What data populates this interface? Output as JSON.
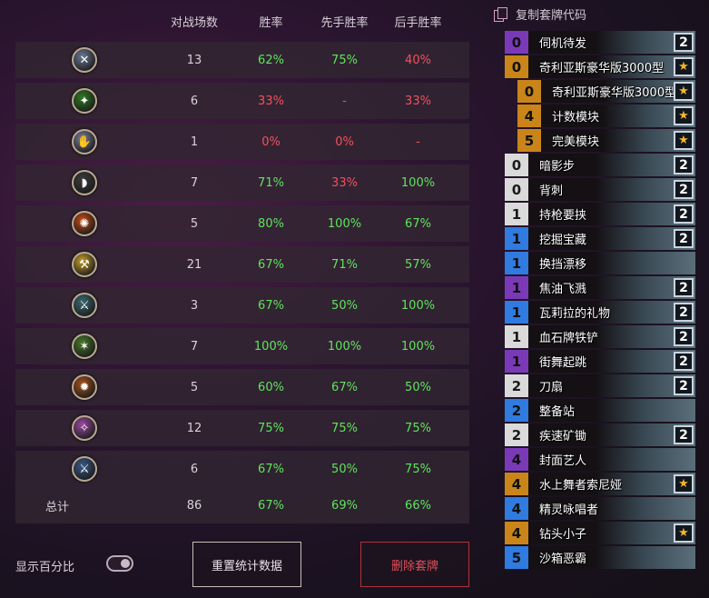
{
  "stats": {
    "headers": {
      "games": "对战场数",
      "winrate": "胜率",
      "first": "先手胜率",
      "second": "后手胜率"
    },
    "rows": [
      {
        "icon": "warrior-class-icon",
        "icon_color": "#6c7a96",
        "glyph": "✕",
        "games": "13",
        "winrate": "62%",
        "first": "75%",
        "second": "40%"
      },
      {
        "icon": "druid-class-icon",
        "icon_color": "#2f7a22",
        "glyph": "✦",
        "games": "6",
        "winrate": "33%",
        "first": "-",
        "second": "33%"
      },
      {
        "icon": "shaman-class-icon",
        "icon_color": "#7a7f9a",
        "glyph": "✋",
        "games": "1",
        "winrate": "0%",
        "first": "0%",
        "second": "-"
      },
      {
        "icon": "rogue-class-icon",
        "icon_color": "#3b3b3b",
        "glyph": "◗",
        "games": "7",
        "winrate": "71%",
        "first": "33%",
        "second": "100%"
      },
      {
        "icon": "mage-class-icon",
        "icon_color": "#c24a16",
        "glyph": "✺",
        "games": "5",
        "winrate": "80%",
        "first": "100%",
        "second": "67%"
      },
      {
        "icon": "paladin-class-icon",
        "icon_color": "#c8a02a",
        "glyph": "⚒",
        "games": "21",
        "winrate": "67%",
        "first": "71%",
        "second": "57%"
      },
      {
        "icon": "hunter-class-icon",
        "icon_color": "#3a6a70",
        "glyph": "⚔",
        "games": "3",
        "winrate": "67%",
        "first": "50%",
        "second": "100%"
      },
      {
        "icon": "demon-hunter-class-icon",
        "icon_color": "#4a7a2a",
        "glyph": "✶",
        "games": "7",
        "winrate": "100%",
        "first": "100%",
        "second": "100%"
      },
      {
        "icon": "warlock-class-icon",
        "icon_color": "#a8521a",
        "glyph": "✹",
        "games": "5",
        "winrate": "60%",
        "first": "67%",
        "second": "50%"
      },
      {
        "icon": "priest-class-icon",
        "icon_color": "#9a4aa0",
        "glyph": "✧",
        "games": "12",
        "winrate": "75%",
        "first": "75%",
        "second": "75%"
      },
      {
        "icon": "death-knight-class-icon",
        "icon_color": "#3a5a8a",
        "glyph": "⚔",
        "games": "6",
        "winrate": "67%",
        "first": "50%",
        "second": "75%"
      }
    ],
    "total": {
      "label": "总计",
      "games": "86",
      "winrate": "67%",
      "first": "69%",
      "second": "66%"
    }
  },
  "controls": {
    "show_percent_label": "显示百分比",
    "show_percent_on": true,
    "reset_label": "重置统计数据",
    "delete_label": "删除套牌"
  },
  "deck": {
    "copy_label": "复制套牌代码",
    "cards": [
      {
        "cost": "0",
        "name": "伺机待发",
        "count": "2",
        "rarity": "epic",
        "sub": false
      },
      {
        "cost": "0",
        "name": "奇利亚斯豪华版3000型",
        "count": "★",
        "rarity": "legendary",
        "sub": false
      },
      {
        "cost": "0",
        "name": "奇利亚斯豪华版3000型",
        "count": "★",
        "rarity": "legendary",
        "sub": true
      },
      {
        "cost": "4",
        "name": "计数模块",
        "count": "★",
        "rarity": "legendary",
        "sub": true
      },
      {
        "cost": "5",
        "name": "完美模块",
        "count": "★",
        "rarity": "legendary",
        "sub": true
      },
      {
        "cost": "0",
        "name": "暗影步",
        "count": "2",
        "rarity": "common",
        "sub": false
      },
      {
        "cost": "0",
        "name": "背刺",
        "count": "2",
        "rarity": "common",
        "sub": false
      },
      {
        "cost": "1",
        "name": "持枪要挟",
        "count": "2",
        "rarity": "common",
        "sub": false
      },
      {
        "cost": "1",
        "name": "挖掘宝藏",
        "count": "2",
        "rarity": "rare",
        "sub": false
      },
      {
        "cost": "1",
        "name": "换挡漂移",
        "count": "",
        "rarity": "rare",
        "sub": false
      },
      {
        "cost": "1",
        "name": "焦油飞溅",
        "count": "2",
        "rarity": "epic",
        "sub": false
      },
      {
        "cost": "1",
        "name": "瓦莉拉的礼物",
        "count": "2",
        "rarity": "rare",
        "sub": false
      },
      {
        "cost": "1",
        "name": "血石牌铁铲",
        "count": "2",
        "rarity": "common",
        "sub": false
      },
      {
        "cost": "1",
        "name": "街舞起跳",
        "count": "2",
        "rarity": "epic",
        "sub": false
      },
      {
        "cost": "2",
        "name": "刀扇",
        "count": "2",
        "rarity": "common",
        "sub": false
      },
      {
        "cost": "2",
        "name": "整备站",
        "count": "",
        "rarity": "rare",
        "sub": false
      },
      {
        "cost": "2",
        "name": "疾速矿锄",
        "count": "2",
        "rarity": "common",
        "sub": false
      },
      {
        "cost": "4",
        "name": "封面艺人",
        "count": "",
        "rarity": "epic",
        "sub": false
      },
      {
        "cost": "4",
        "name": "水上舞者索尼娅",
        "count": "★",
        "rarity": "legendary",
        "sub": false
      },
      {
        "cost": "4",
        "name": "精灵咏唱者",
        "count": "",
        "rarity": "rare",
        "sub": false
      },
      {
        "cost": "4",
        "name": "钻头小子",
        "count": "★",
        "rarity": "legendary",
        "sub": false
      },
      {
        "cost": "5",
        "name": "沙箱恶霸",
        "count": "",
        "rarity": "rare",
        "sub": false
      }
    ],
    "rarity_colors": {
      "common": "#dadada",
      "rare": "#2f7be0",
      "epic": "#7a3ab8",
      "legendary": "#c9851a"
    }
  }
}
